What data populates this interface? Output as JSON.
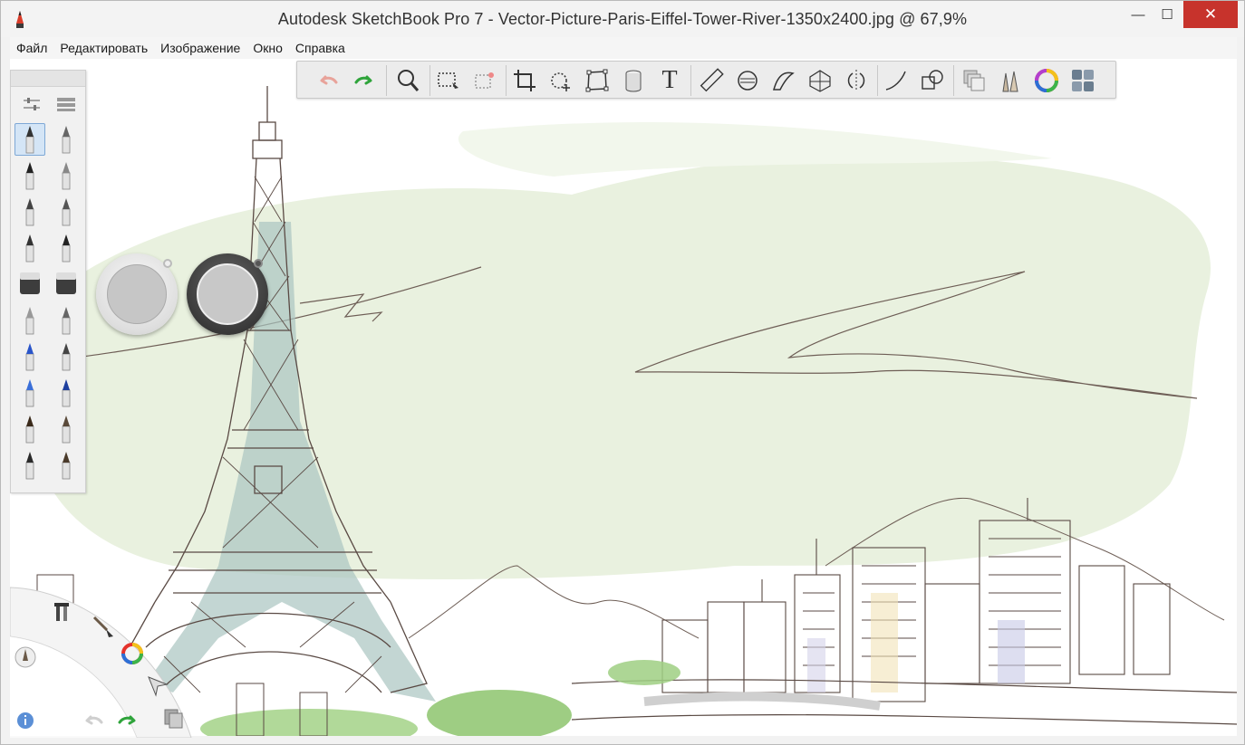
{
  "window": {
    "title": "Autodesk SketchBook Pro 7 - Vector-Picture-Paris-Eiffel-Tower-River-1350x2400.jpg @ 67,9%",
    "minimize_glyph": "—",
    "maximize_glyph": "☐",
    "close_glyph": "✕"
  },
  "menu": {
    "items": [
      "Файл",
      "Редактировать",
      "Изображение",
      "Окно",
      "Справка"
    ]
  },
  "toolbar": {
    "tools": [
      "undo-icon",
      "redo-icon",
      "zoom-icon",
      "rectangle-select-icon",
      "lasso-select-icon",
      "crop-icon",
      "transform-rotate-icon",
      "distort-icon",
      "fill-icon",
      "text-icon",
      "ruler-icon",
      "ellipse-guide-icon",
      "french-curve-icon",
      "perspective-icon",
      "symmetry-icon",
      "stroke-icon",
      "shapes-icon",
      "layers-icon",
      "brush-library-icon",
      "color-wheel-icon",
      "palette-toggle-icon"
    ],
    "text_tool_glyph": "T"
  },
  "brush_palette": {
    "brushes": [
      "pencil-brush",
      "technical-pen-brush",
      "marker-brush",
      "felt-pen-brush",
      "ballpoint-brush",
      "ink-pen-brush",
      "fine-pen-brush",
      "liner-brush",
      "eraser-hard-brush",
      "eraser-soft-brush",
      "airbrush-brush",
      "smudge-brush",
      "blue-marker-brush",
      "chisel-marker-brush",
      "blue-pen-brush",
      "ink-stamp-brush",
      "paint-brush",
      "bristle-brush",
      "flat-brush",
      "fan-brush"
    ],
    "selected": 0
  },
  "pucks": {
    "color_puck": "color-puck",
    "size_puck": "brush-size-puck"
  },
  "lagoon": {
    "items": [
      "tools-icon",
      "brush-icon",
      "color-wheel-icon",
      "select-arrow-icon",
      "undo-icon",
      "redo-icon",
      "layers-icon",
      "pencil-icon",
      "info-icon"
    ]
  },
  "colors": {
    "sky_wash": "#e8f0dd",
    "tower_wash": "#a9c4c0",
    "ink": "#5a4a44",
    "tree_green": "#8dc46d",
    "close_red": "#c7332c",
    "redo_green": "#2fa43b",
    "undo_pink": "#e8a39a"
  }
}
